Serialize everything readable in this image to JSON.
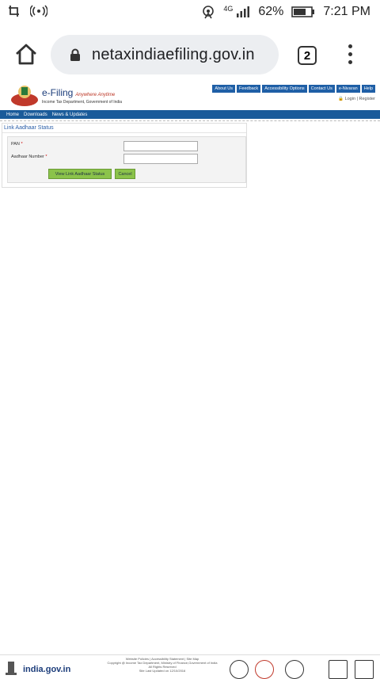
{
  "status": {
    "time": "7:21 PM",
    "battery": "62%",
    "network": "4G"
  },
  "browser": {
    "url": "netaxindiaefiling.gov.in",
    "tab_count": "2"
  },
  "site": {
    "brand": "e-Filing",
    "tagline": "Anywhere Anytime",
    "department": "Income Tax Department, Government of India",
    "top_nav": [
      "About Us",
      "Feedback",
      "Accessibility Options",
      "Contact Us",
      "e-Nivaran",
      "Help"
    ],
    "login_register": "Login | Register",
    "main_nav": [
      "Home",
      "Downloads",
      "News & Updates"
    ]
  },
  "form": {
    "title": "Link Aadhaar Status",
    "pan_label": "PAN",
    "aadhaar_label": "Aadhaar Number",
    "required_mark": "*",
    "view_button": "View Link Aadhaar Status",
    "cancel_button": "Cancel"
  },
  "footer": {
    "links": "Website Policies | Accessibility Statement | Site Map",
    "copyright": "Copyright @ Income Tax Department, Ministry of Finance,Government of India",
    "rights": "All Rights Reserved",
    "updated": "Site Last Updated on 12/10/2016",
    "india_gov": "india.gov.in"
  },
  "colors": {
    "nav_blue": "#1a5b9a",
    "button_green": "#8bc34a",
    "link_blue": "#2a5ea8"
  }
}
